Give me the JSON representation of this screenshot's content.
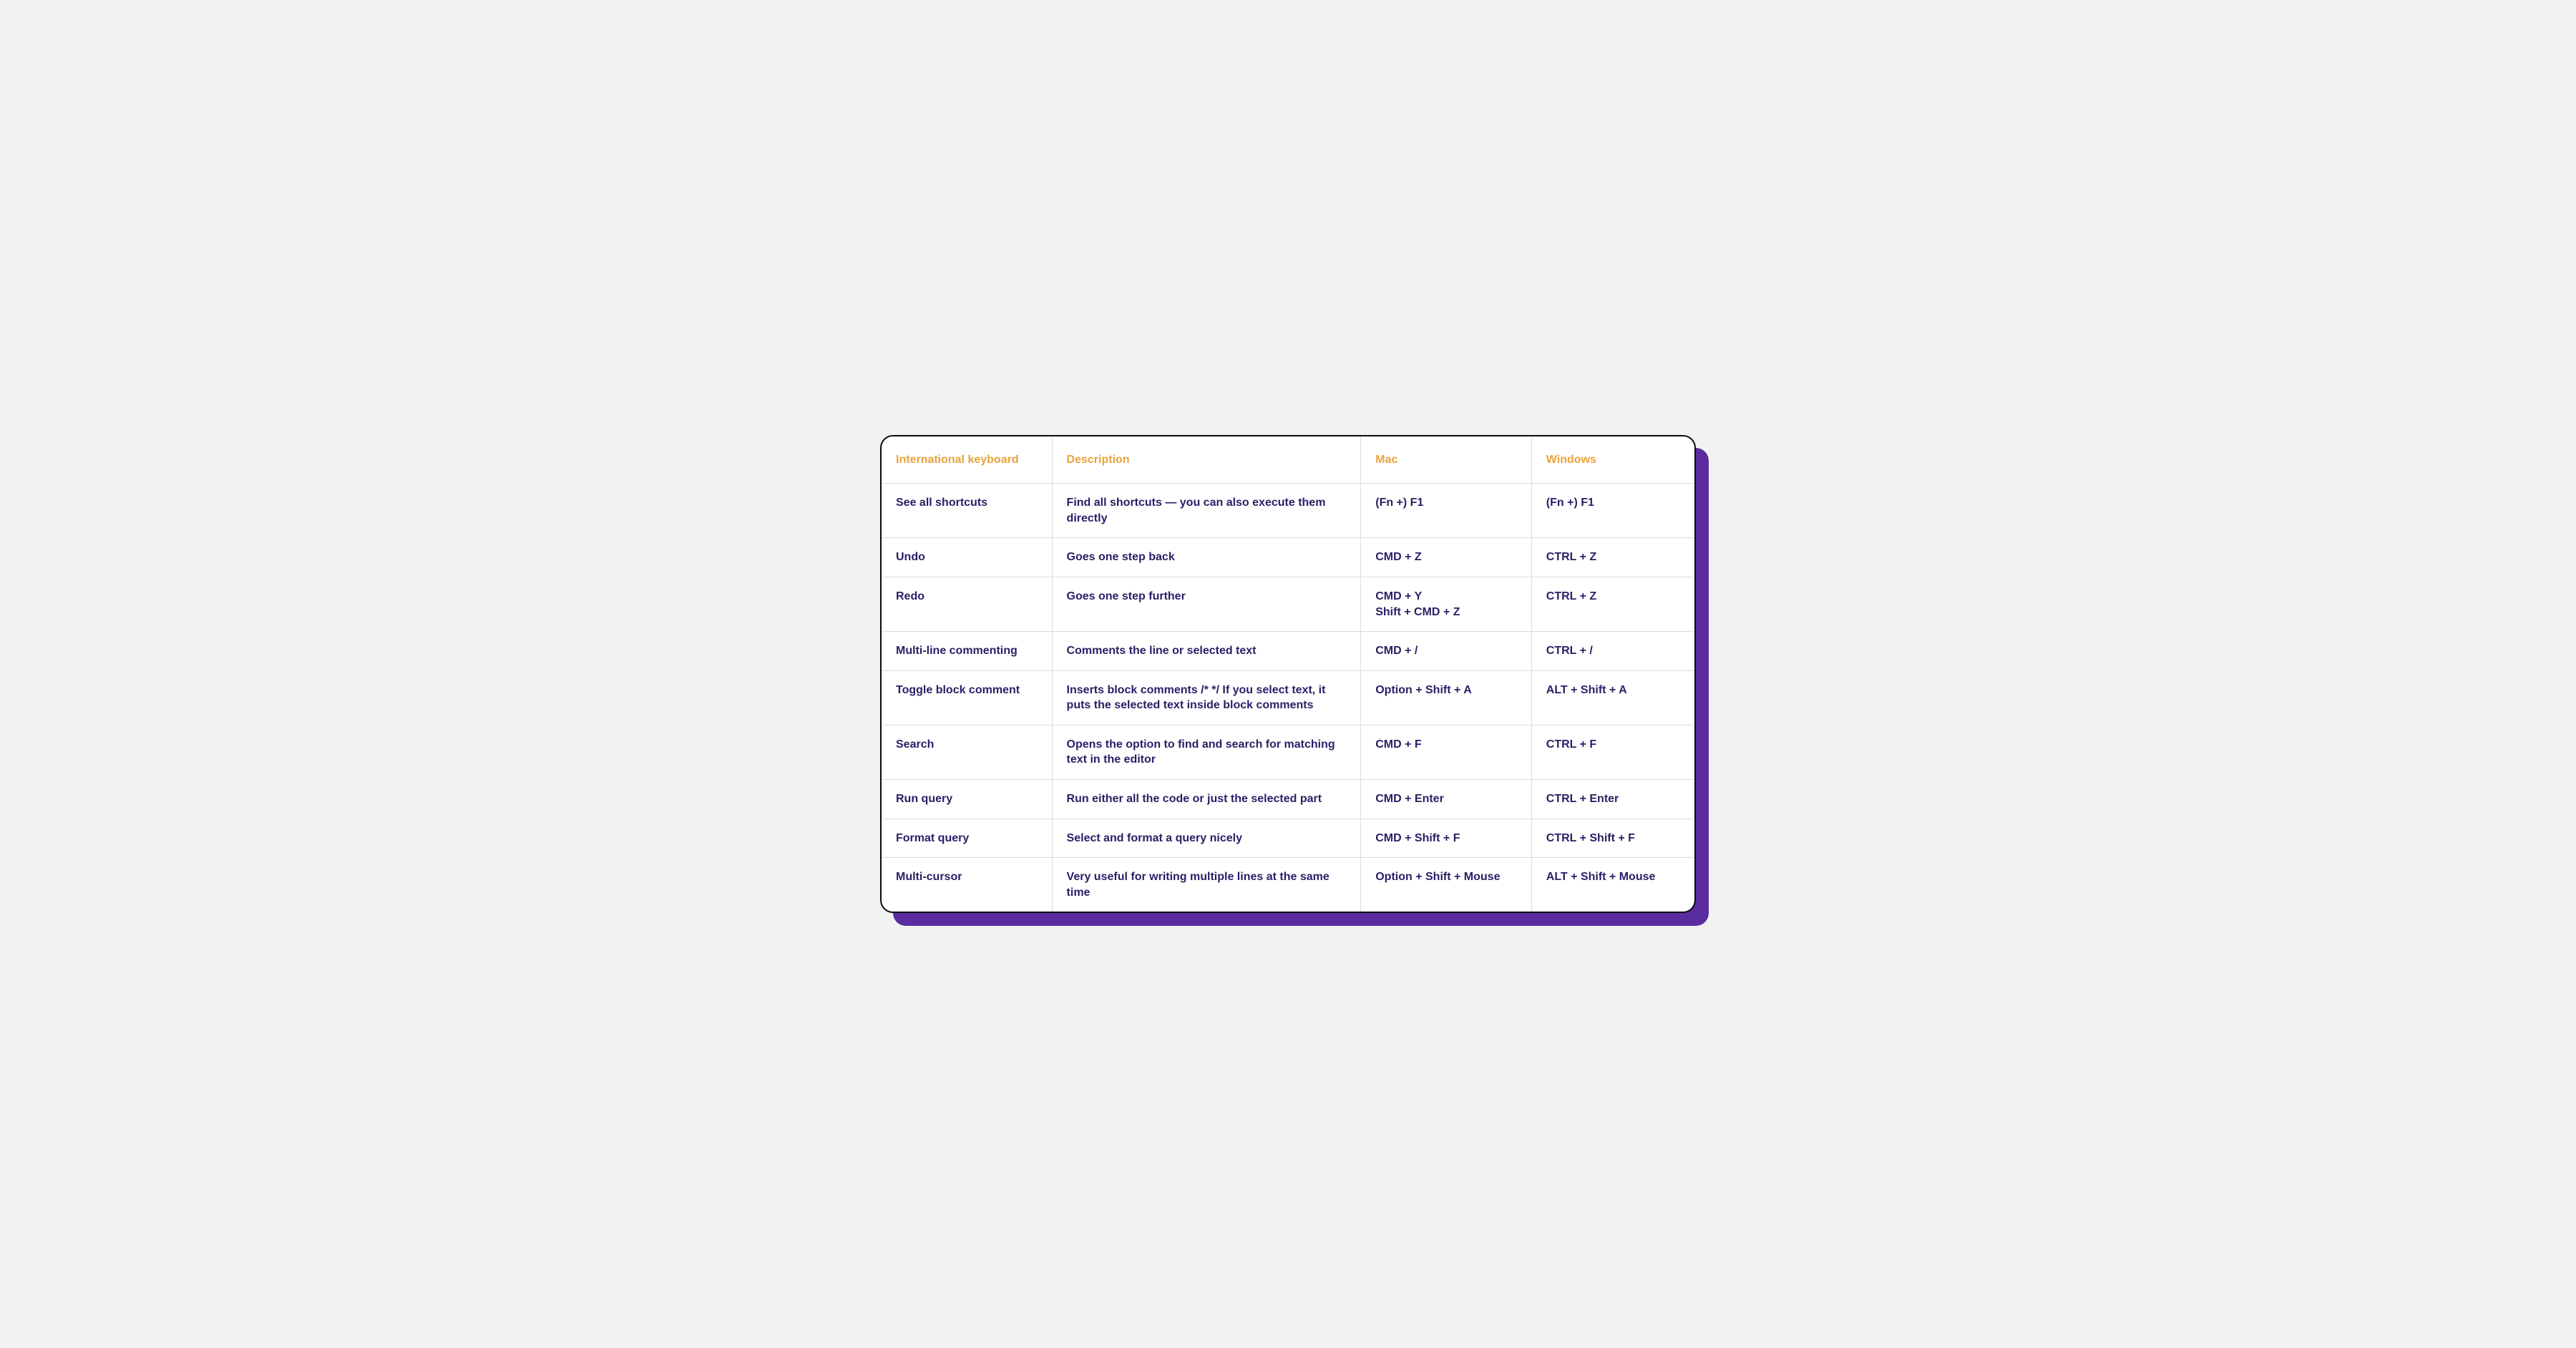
{
  "columns": [
    "International keyboard",
    "Description",
    "Mac",
    "Windows"
  ],
  "rows": [
    {
      "name": [
        "See all shortcuts"
      ],
      "desc": [
        "Find all shortcuts — you can also execute them directly"
      ],
      "mac": [
        "(Fn +) F1"
      ],
      "windows": [
        "(Fn +) F1"
      ]
    },
    {
      "name": [
        "Undo"
      ],
      "desc": [
        "Goes one step back"
      ],
      "mac": [
        "CMD + Z"
      ],
      "windows": [
        "CTRL + Z"
      ]
    },
    {
      "name": [
        "Redo"
      ],
      "desc": [
        "Goes one step further"
      ],
      "mac": [
        "CMD + Y",
        "Shift + CMD + Z"
      ],
      "windows": [
        "CTRL + Z"
      ]
    },
    {
      "name": [
        "Multi-line commenting"
      ],
      "desc": [
        "Comments the line or selected text"
      ],
      "mac": [
        "CMD + /"
      ],
      "windows": [
        "CTRL + /"
      ]
    },
    {
      "name": [
        "Toggle block comment"
      ],
      "desc": [
        "Inserts block comments /* */ If you select text, it puts the selected text inside block comments"
      ],
      "mac": [
        "Option + Shift + A"
      ],
      "windows": [
        "ALT + Shift + A"
      ]
    },
    {
      "name": [
        "Search"
      ],
      "desc": [
        "Opens the option to find and search for matching text in the editor"
      ],
      "mac": [
        "CMD + F"
      ],
      "windows": [
        "CTRL + F"
      ]
    },
    {
      "name": [
        "Run query"
      ],
      "desc": [
        "Run either all the code or just the selected part"
      ],
      "mac": [
        "CMD + Enter"
      ],
      "windows": [
        "CTRL + Enter"
      ]
    },
    {
      "name": [
        "Format query"
      ],
      "desc": [
        "Select and format a query nicely"
      ],
      "mac": [
        "CMD + Shift + F"
      ],
      "windows": [
        "CTRL + Shift + F"
      ]
    },
    {
      "name": [
        "Multi-cursor"
      ],
      "desc": [
        "Very useful for writing multiple lines at the same time"
      ],
      "mac": [
        "Option + Shift + Mouse"
      ],
      "windows": [
        "ALT + Shift + Mouse"
      ]
    }
  ]
}
